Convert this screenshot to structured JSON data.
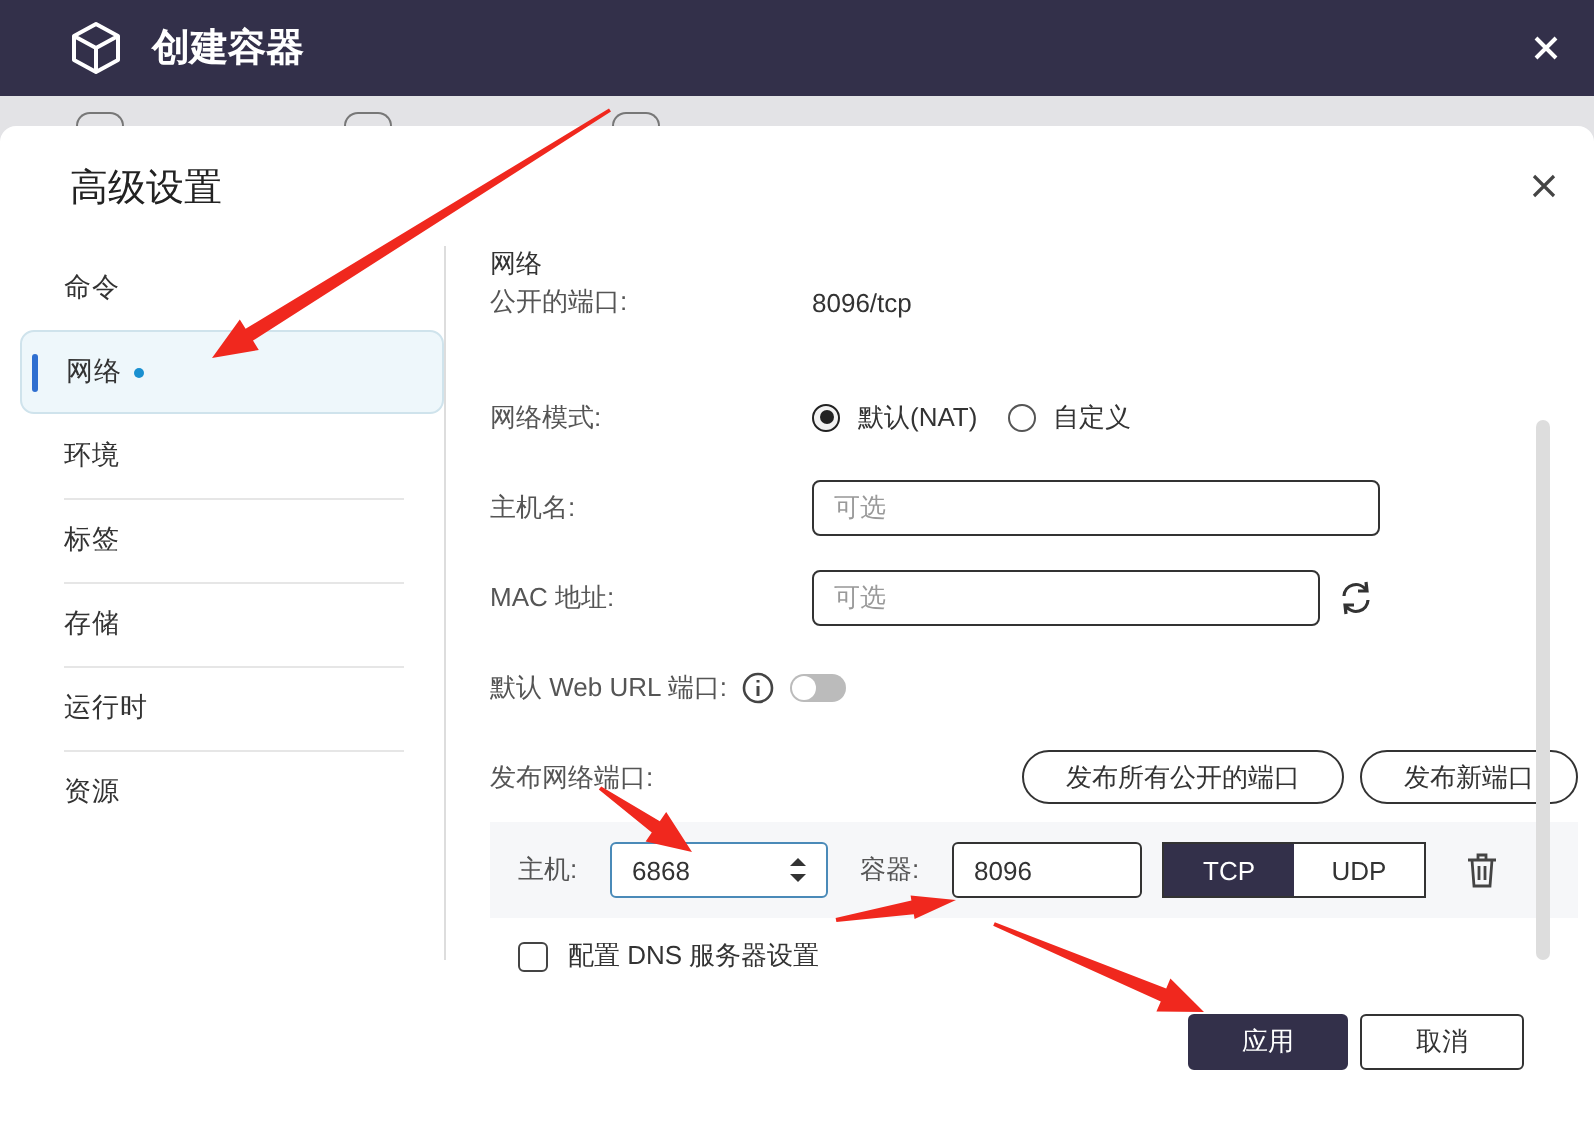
{
  "window": {
    "title": "创建容器"
  },
  "steps": [
    {
      "done": false
    },
    {
      "done": false
    },
    {
      "done": false
    }
  ],
  "dialog": {
    "title": "高级设置"
  },
  "sidebar": {
    "items": [
      {
        "label": "命令",
        "selected": false,
        "modified": false
      },
      {
        "label": "网络",
        "selected": true,
        "modified": true
      },
      {
        "label": "环境",
        "selected": false,
        "modified": false
      },
      {
        "label": "标签",
        "selected": false,
        "modified": false
      },
      {
        "label": "存储",
        "selected": false,
        "modified": false
      },
      {
        "label": "运行时",
        "selected": false,
        "modified": false
      },
      {
        "label": "资源",
        "selected": false,
        "modified": false
      }
    ]
  },
  "section": {
    "title": "网络"
  },
  "exposed_ports": {
    "label": "公开的端口:",
    "value": "8096/tcp"
  },
  "network_mode": {
    "label": "网络模式:",
    "options": [
      {
        "label": "默认(NAT)",
        "selected": true
      },
      {
        "label": "自定义",
        "selected": false
      }
    ]
  },
  "hostname": {
    "label": "主机名:",
    "placeholder": "可选"
  },
  "mac": {
    "label": "MAC 地址:",
    "placeholder": "可选"
  },
  "web_url_port": {
    "label": "默认 Web URL 端口:",
    "on": false
  },
  "publish": {
    "label": "发布网络端口:",
    "buttons": [
      "发布所有公开的端口",
      "发布新端口"
    ]
  },
  "port_mappings": [
    {
      "host_label": "主机:",
      "host_value": "6868",
      "container_label": "容器:",
      "container_value": "8096",
      "protocols": [
        {
          "label": "TCP",
          "selected": true
        },
        {
          "label": "UDP",
          "selected": false
        }
      ]
    }
  ],
  "dns": {
    "label": "配置 DNS 服务器设置",
    "checked": false
  },
  "footer": {
    "buttons": [
      {
        "label": "应用",
        "kind": "primary"
      },
      {
        "label": "取消",
        "kind": "secondary"
      }
    ]
  }
}
